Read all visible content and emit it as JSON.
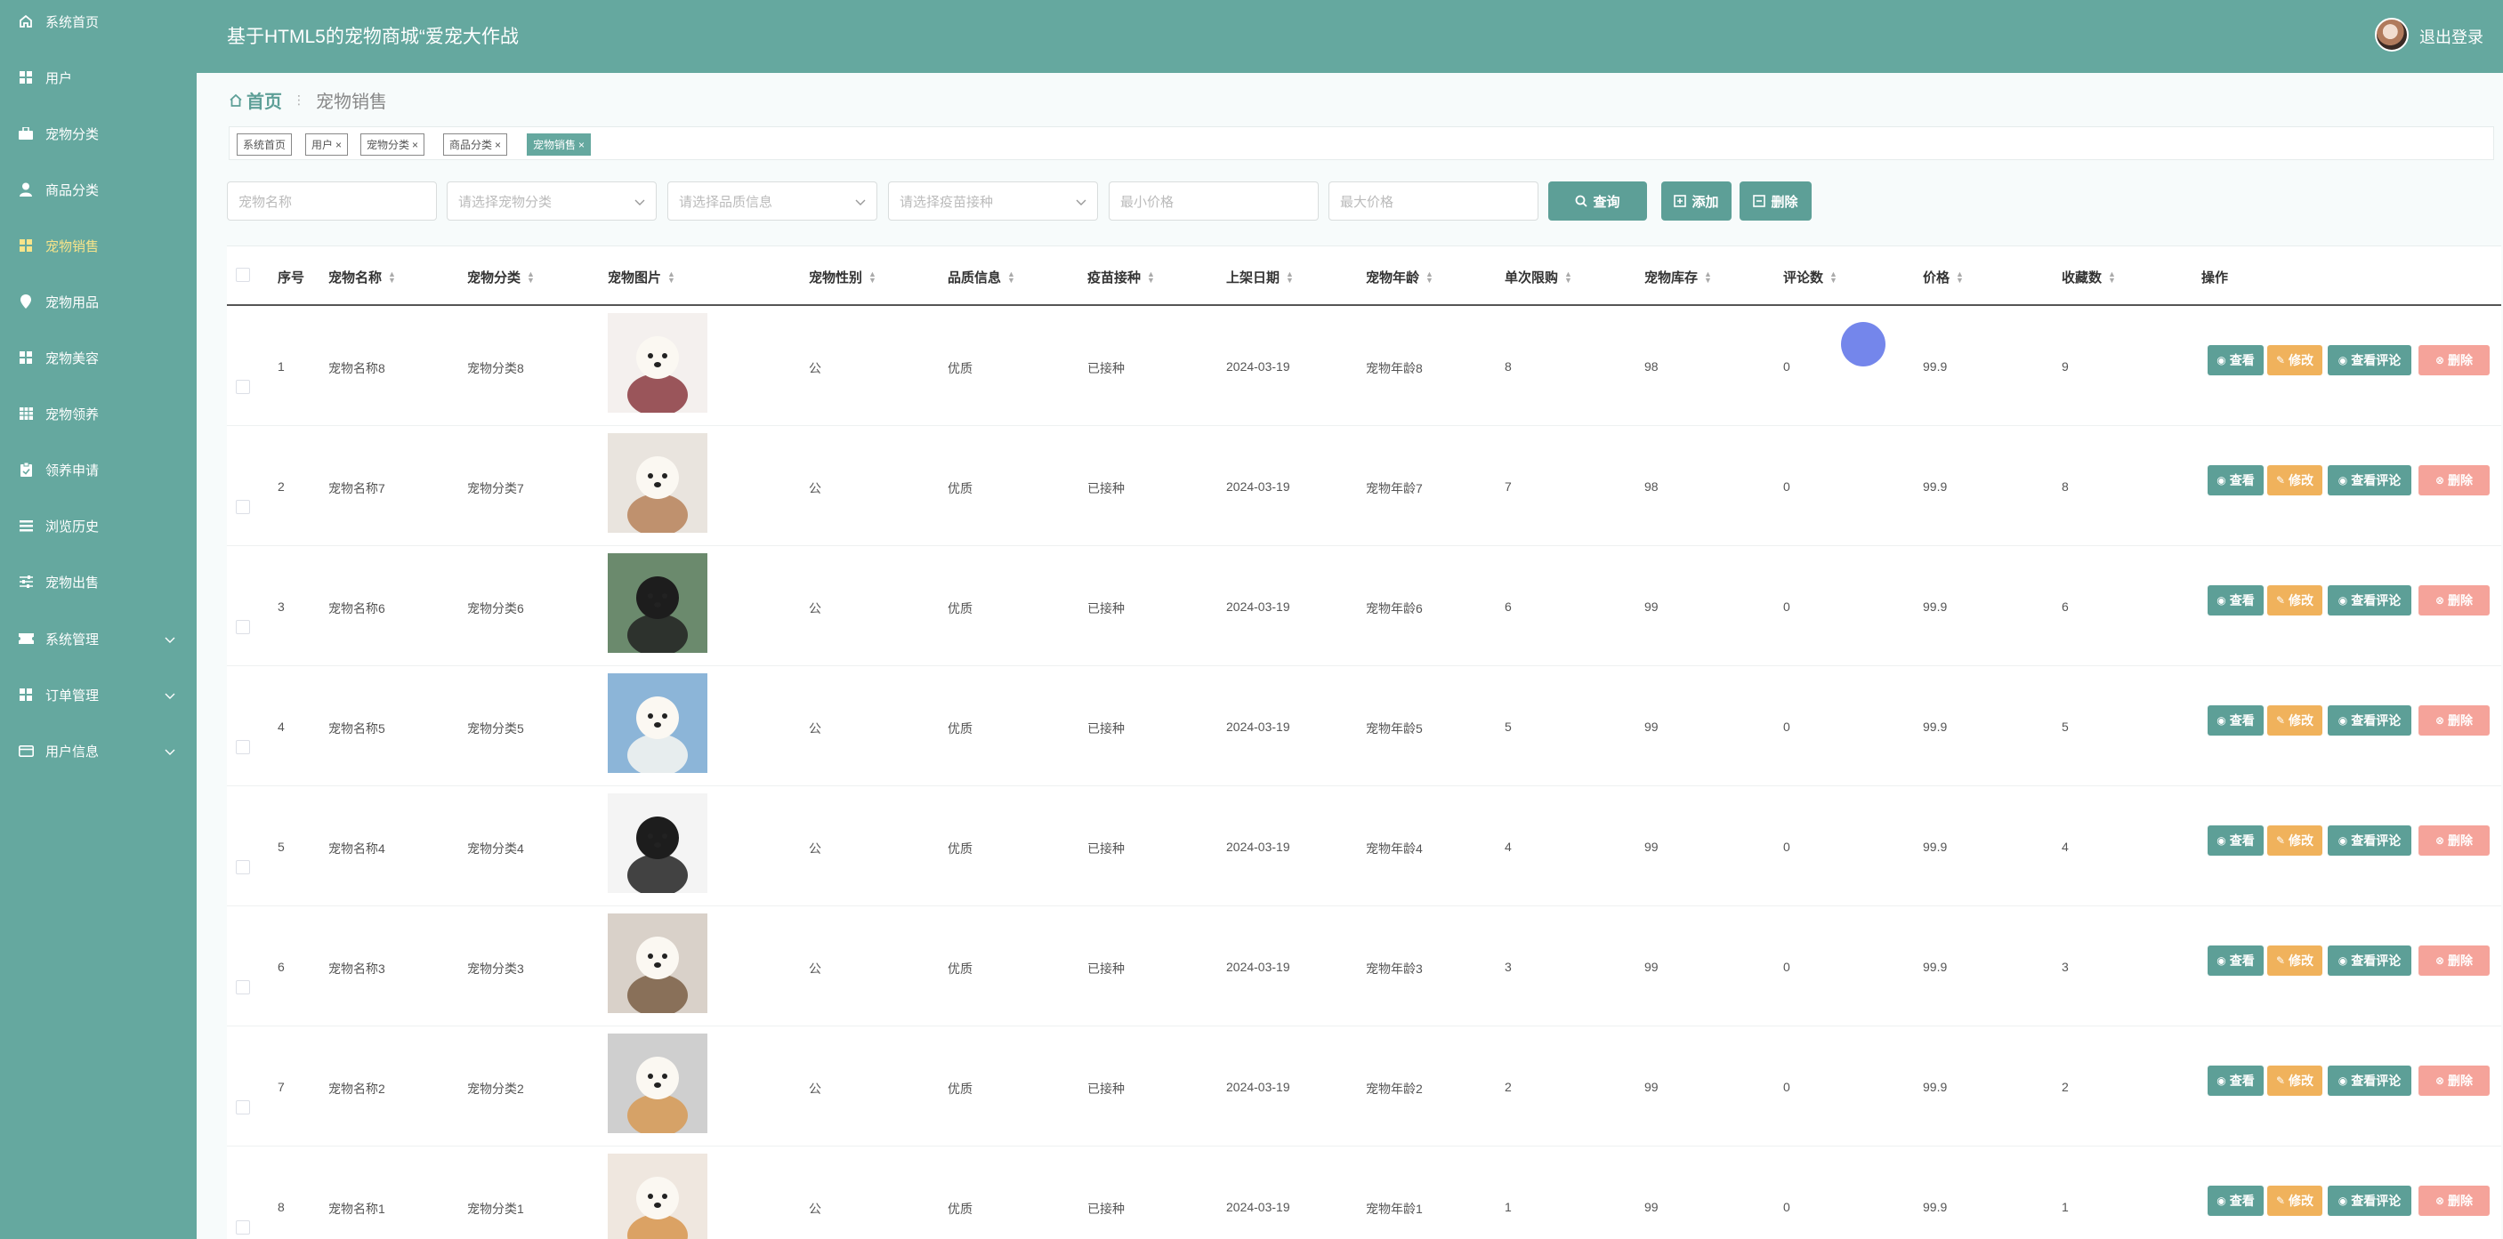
{
  "app": {
    "title": "基于HTML5的宠物商城“爱宠大作战",
    "logout_label": "退出登录"
  },
  "sidebar": {
    "items": [
      {
        "label": "系统首页",
        "icon": "home-icon"
      },
      {
        "label": "用户",
        "icon": "grid-icon"
      },
      {
        "label": "宠物分类",
        "icon": "briefcase-icon"
      },
      {
        "label": "商品分类",
        "icon": "user-icon"
      },
      {
        "label": "宠物销售",
        "icon": "grid-icon",
        "active": true
      },
      {
        "label": "宠物用品",
        "icon": "pin-icon"
      },
      {
        "label": "宠物美容",
        "icon": "grid-icon"
      },
      {
        "label": "宠物领养",
        "icon": "table-icon"
      },
      {
        "label": "领养申请",
        "icon": "clipboard-icon"
      },
      {
        "label": "浏览历史",
        "icon": "list-icon"
      },
      {
        "label": "宠物出售",
        "icon": "sliders-icon"
      },
      {
        "label": "系统管理",
        "icon": "ticket-icon",
        "has_submenu": true
      },
      {
        "label": "订单管理",
        "icon": "grid-icon",
        "has_submenu": true
      },
      {
        "label": "用户信息",
        "icon": "card-icon",
        "has_submenu": true
      }
    ]
  },
  "breadcrumb": {
    "home": "首页",
    "current": "宠物销售"
  },
  "tags": [
    {
      "label": "系统首页",
      "closable": false
    },
    {
      "label": "用户",
      "closable": true
    },
    {
      "label": "宠物分类",
      "closable": true
    },
    {
      "label": "商品分类",
      "closable": true
    },
    {
      "label": "宠物销售",
      "closable": true,
      "active": true
    }
  ],
  "filters": {
    "name_placeholder": "宠物名称",
    "category_placeholder": "请选择宠物分类",
    "quality_placeholder": "请选择品质信息",
    "vaccine_placeholder": "请选择疫苗接种",
    "min_price_placeholder": "最小价格",
    "max_price_placeholder": "最大价格"
  },
  "toolbar": {
    "search_label": "查询",
    "add_label": "添加",
    "delete_label": "删除"
  },
  "table": {
    "columns": [
      "序号",
      "宠物名称",
      "宠物分类",
      "宠物图片",
      "宠物性别",
      "品质信息",
      "疫苗接种",
      "上架日期",
      "宠物年龄",
      "单次限购",
      "宠物库存",
      "评论数",
      "价格",
      "收藏数",
      "操作"
    ],
    "rows": [
      {
        "index": "1",
        "name": "宠物名称8",
        "category": "宠物分类8",
        "gender": "公",
        "quality": "优质",
        "vaccine": "已接种",
        "date": "2024-03-19",
        "age": "宠物年龄8",
        "limit": "8",
        "stock": "98",
        "comments": "0",
        "price": "99.9",
        "favorites": "9"
      },
      {
        "index": "2",
        "name": "宠物名称7",
        "category": "宠物分类7",
        "gender": "公",
        "quality": "优质",
        "vaccine": "已接种",
        "date": "2024-03-19",
        "age": "宠物年龄7",
        "limit": "7",
        "stock": "98",
        "comments": "0",
        "price": "99.9",
        "favorites": "8"
      },
      {
        "index": "3",
        "name": "宠物名称6",
        "category": "宠物分类6",
        "gender": "公",
        "quality": "优质",
        "vaccine": "已接种",
        "date": "2024-03-19",
        "age": "宠物年龄6",
        "limit": "6",
        "stock": "99",
        "comments": "0",
        "price": "99.9",
        "favorites": "6"
      },
      {
        "index": "4",
        "name": "宠物名称5",
        "category": "宠物分类5",
        "gender": "公",
        "quality": "优质",
        "vaccine": "已接种",
        "date": "2024-03-19",
        "age": "宠物年龄5",
        "limit": "5",
        "stock": "99",
        "comments": "0",
        "price": "99.9",
        "favorites": "5"
      },
      {
        "index": "5",
        "name": "宠物名称4",
        "category": "宠物分类4",
        "gender": "公",
        "quality": "优质",
        "vaccine": "已接种",
        "date": "2024-03-19",
        "age": "宠物年龄4",
        "limit": "4",
        "stock": "99",
        "comments": "0",
        "price": "99.9",
        "favorites": "4"
      },
      {
        "index": "6",
        "name": "宠物名称3",
        "category": "宠物分类3",
        "gender": "公",
        "quality": "优质",
        "vaccine": "已接种",
        "date": "2024-03-19",
        "age": "宠物年龄3",
        "limit": "3",
        "stock": "99",
        "comments": "0",
        "price": "99.9",
        "favorites": "3"
      },
      {
        "index": "7",
        "name": "宠物名称2",
        "category": "宠物分类2",
        "gender": "公",
        "quality": "优质",
        "vaccine": "已接种",
        "date": "2024-03-19",
        "age": "宠物年龄2",
        "limit": "2",
        "stock": "99",
        "comments": "0",
        "price": "99.9",
        "favorites": "2"
      },
      {
        "index": "8",
        "name": "宠物名称1",
        "category": "宠物分类1",
        "gender": "公",
        "quality": "优质",
        "vaccine": "已接种",
        "date": "2024-03-19",
        "age": "宠物年龄1",
        "limit": "1",
        "stock": "99",
        "comments": "0",
        "price": "99.9",
        "favorites": "1"
      }
    ],
    "actions": {
      "view": "查看",
      "edit": "修改",
      "review": "查看评论",
      "delete": "删除"
    }
  },
  "colors": {
    "primary": "#65a89f",
    "button": "#5d9f97",
    "edit": "#f0b25c",
    "danger": "#f5a39a",
    "active_menu": "#f7e48a"
  }
}
